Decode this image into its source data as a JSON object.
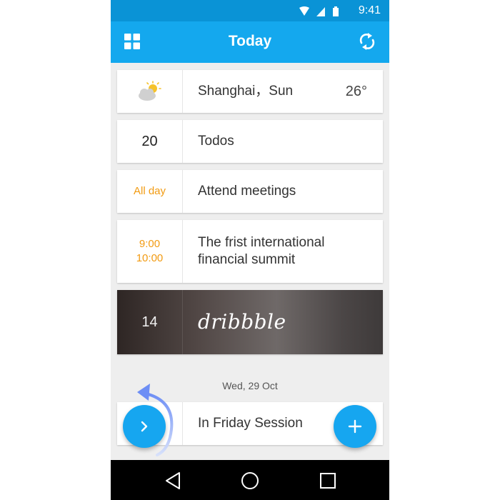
{
  "status_bar": {
    "time": "9:41"
  },
  "app_bar": {
    "title": "Today",
    "menu_icon": "grid-icon",
    "refresh_icon": "refresh-icon"
  },
  "cards": {
    "weather": {
      "icon": "partly-cloudy-icon",
      "location": "Shanghai，Sun",
      "temperature": "26°"
    },
    "todos": {
      "count": "20",
      "label": "Todos"
    },
    "meeting": {
      "time": "All day",
      "title": "Attend meetings"
    },
    "summit": {
      "start": "9:00",
      "end": "10:00",
      "title_line1": "The frist international",
      "title_line2": "financial summit"
    },
    "dribbble": {
      "count": "14",
      "label": "dribbble"
    },
    "friday": {
      "title": "In Friday Session"
    }
  },
  "date_label": "Wed, 29 Oct",
  "fab_left": {
    "icon": "chevron-right-icon"
  },
  "fab_right": {
    "icon": "plus-icon"
  },
  "colors": {
    "status_bar": "#0a93d6",
    "app_bar": "#14a8ee",
    "accent_orange": "#f29b12",
    "fab": "#16a6f0"
  }
}
